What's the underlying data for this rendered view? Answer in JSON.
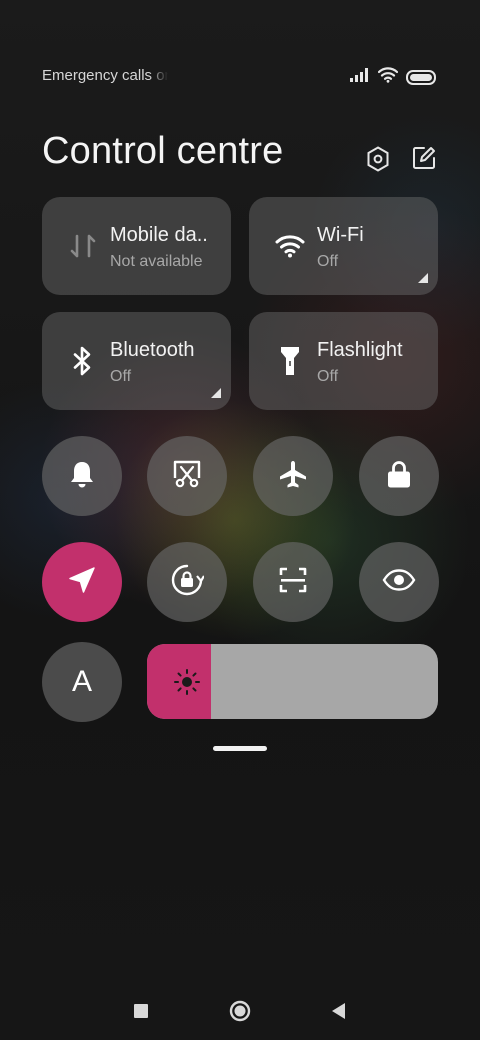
{
  "status_bar": {
    "text": "Emergency calls only",
    "icons": [
      "signal-icon",
      "wifi-icon",
      "battery-icon"
    ]
  },
  "header": {
    "title": "Control centre",
    "icons": [
      "settings-icon",
      "edit-icon"
    ]
  },
  "tiles": [
    {
      "name": "Mobile da..",
      "status": "Not available",
      "icon": "mobile-data-icon"
    },
    {
      "name": "Wi-Fi",
      "status": "Off",
      "icon": "wifi-icon"
    },
    {
      "name": "Bluetooth",
      "status": "Off",
      "icon": "bluetooth-icon"
    },
    {
      "name": "Flashlight",
      "status": "Off",
      "icon": "flashlight-icon"
    }
  ],
  "toggles": [
    {
      "icon": "bell-icon",
      "active": false
    },
    {
      "icon": "screenshot-icon",
      "active": false
    },
    {
      "icon": "airplane-icon",
      "active": false
    },
    {
      "icon": "lock-icon",
      "active": false
    },
    {
      "icon": "location-icon",
      "active": true
    },
    {
      "icon": "rotation-lock-icon",
      "active": false
    },
    {
      "icon": "scanner-icon",
      "active": false
    },
    {
      "icon": "eye-icon",
      "active": false
    },
    {
      "icon": "font-icon",
      "label": "A",
      "active": false
    }
  ],
  "brightness": {
    "level": 0.22,
    "icon": "sun-icon"
  },
  "colors": {
    "accent": "#c2306c",
    "tile_bg": "#6e6e6e",
    "slider_track": "#a7a7a7"
  },
  "navbar": {
    "icons": [
      "recents-icon",
      "home-icon",
      "back-icon"
    ]
  }
}
